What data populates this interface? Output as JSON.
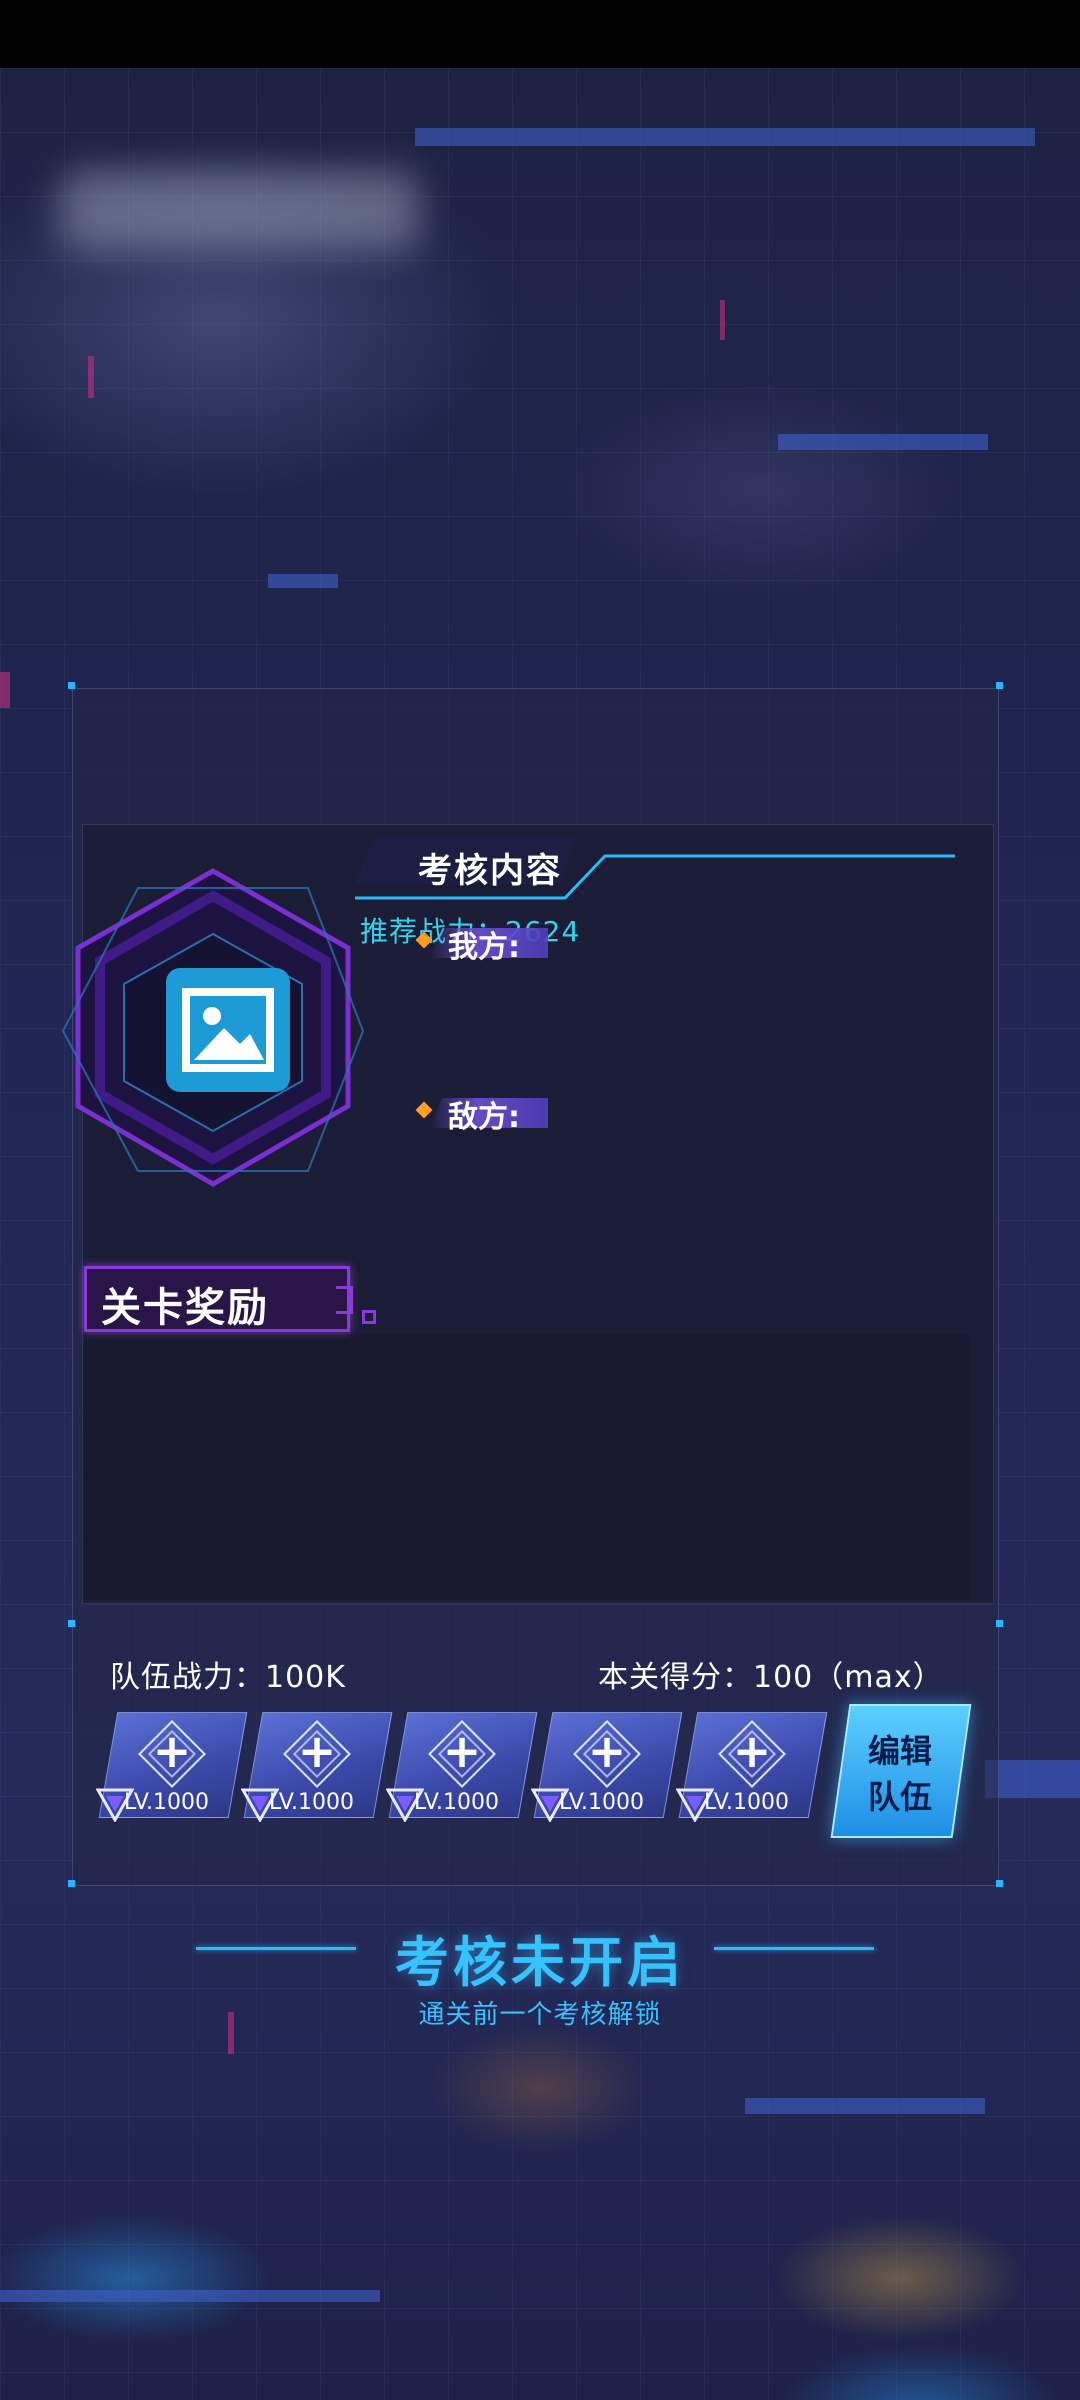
{
  "assessment": {
    "title": "考核内容",
    "recommended_power": "推荐战力：2624",
    "my_side_label": "我方:",
    "enemy_side_label": "敌方:",
    "image_placeholder_icon": "image-icon"
  },
  "rewards": {
    "title": "关卡奖励"
  },
  "team": {
    "power_label": "队伍战力：100K",
    "score_label": "本关得分：100（max）",
    "slots": [
      {
        "level": "LV.1000",
        "icon": "plus-icon"
      },
      {
        "level": "LV.1000",
        "icon": "plus-icon"
      },
      {
        "level": "LV.1000",
        "icon": "plus-icon"
      },
      {
        "level": "LV.1000",
        "icon": "plus-icon"
      },
      {
        "level": "LV.1000",
        "icon": "plus-icon"
      }
    ],
    "edit_button_line1": "编辑",
    "edit_button_line2": "队伍"
  },
  "locked": {
    "title": "考核未开启",
    "subtitle": "通关前一个考核解锁"
  },
  "colors": {
    "accent_cyan": "#35c2ff",
    "accent_purple": "#8a3ad8",
    "accent_orange": "#ff9c28"
  }
}
